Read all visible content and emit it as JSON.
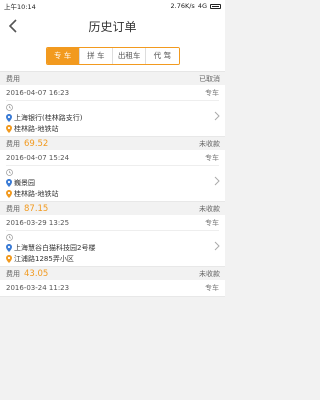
{
  "status_bar": {
    "time": "上午10:14",
    "network_speed": "2.76K/s",
    "network": "4G"
  },
  "header": {
    "title": "历史订单",
    "back_icon": "chevron-left-icon"
  },
  "tabs": [
    {
      "label": "专 车",
      "active": true
    },
    {
      "label": "拼 车",
      "active": false
    },
    {
      "label": "出租车",
      "active": false
    },
    {
      "label": "代 驾",
      "active": false
    }
  ],
  "orders": [
    {
      "fee_label": "费用",
      "fee_amount": "",
      "status": "已取消",
      "datetime": "2016-04-07 16:23",
      "type": "专车",
      "from": "上海银行(桂林路支行)",
      "to": "桂林路-地铁站"
    },
    {
      "fee_label": "费用",
      "fee_amount": "69.52",
      "status": "未收款",
      "datetime": "2016-04-07 15:24",
      "type": "专车",
      "from": "巍景园",
      "to": "桂林路-地铁站"
    },
    {
      "fee_label": "费用",
      "fee_amount": "87.15",
      "status": "未收款",
      "datetime": "2016-03-29 13:25",
      "type": "专车",
      "from": "上海慧谷白猫科技园2号楼",
      "to": "江浦路1285弄小区"
    },
    {
      "fee_label": "费用",
      "fee_amount": "43.05",
      "status": "未收款",
      "datetime": "2016-03-24 11:23",
      "type": "专车",
      "from": "",
      "to": ""
    }
  ],
  "colors": {
    "accent": "#f29a1f",
    "pin_from": "#3a7bd5",
    "pin_to": "#f29a1f"
  }
}
